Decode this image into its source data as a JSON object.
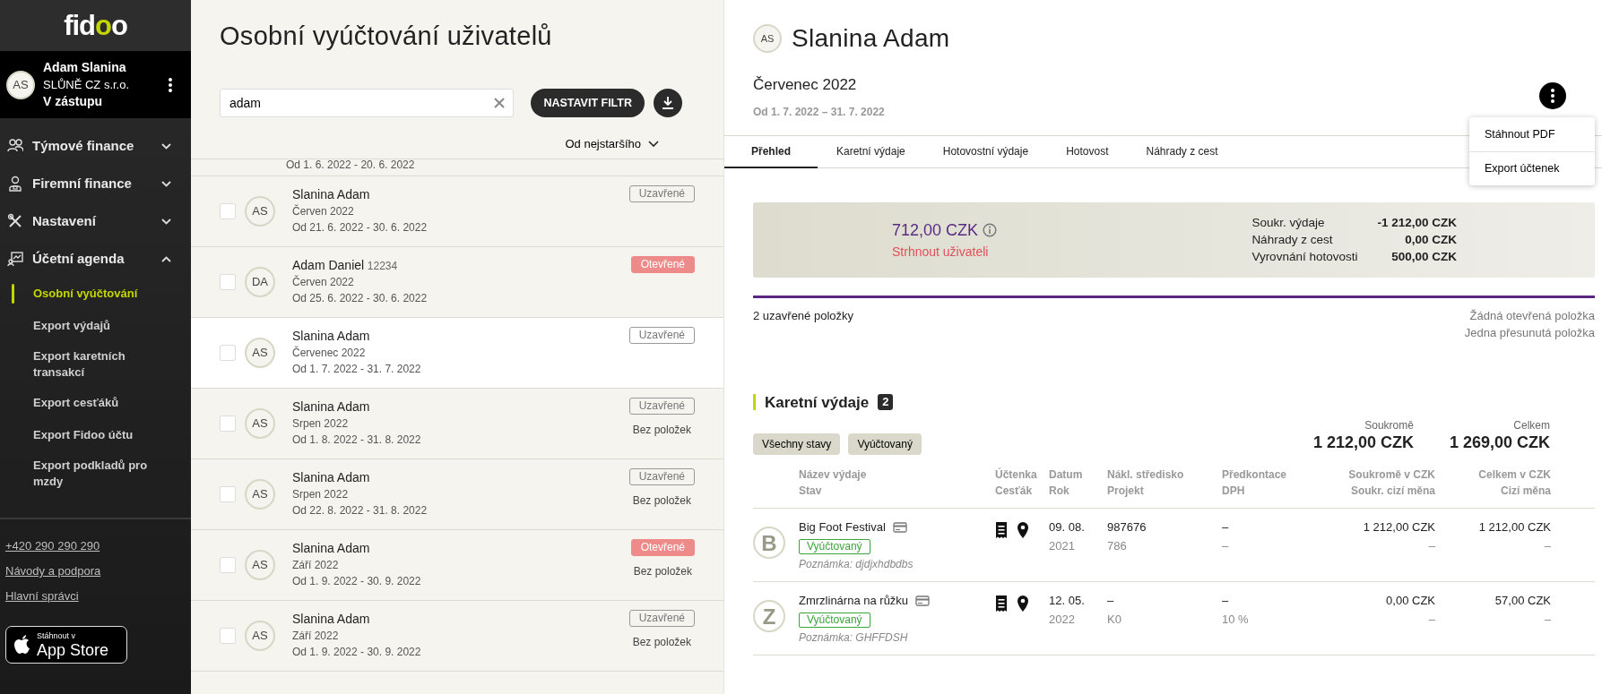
{
  "sidebar": {
    "logo_parts": [
      {
        "text": "fid",
        "accent": false
      },
      {
        "text": "o",
        "accent": true
      },
      {
        "text": "o",
        "accent": false
      }
    ],
    "user": {
      "initials": "AS",
      "name": "Adam Slanina",
      "company": "SLŮNĚ CZ s.r.o.",
      "role": "V zástupu"
    },
    "nav": [
      {
        "label": "Týmové finance",
        "expanded": false
      },
      {
        "label": "Firemní finance",
        "expanded": false
      },
      {
        "label": "Nastavení",
        "expanded": false
      },
      {
        "label": "Účetní agenda",
        "expanded": true,
        "children": [
          {
            "label": "Osobní vyúčtování",
            "selected": true
          },
          {
            "label": "Export výdajů",
            "selected": false
          },
          {
            "label": "Export karetních transakcí",
            "selected": false
          },
          {
            "label": "Export cesťáků",
            "selected": false
          },
          {
            "label": "Export Fidoo účtu",
            "selected": false
          },
          {
            "label": "Export podkladů pro mzdy",
            "selected": false
          }
        ]
      }
    ],
    "footer_links": [
      "+420 290 290 290",
      "Návody a podpora",
      "Hlavní správci"
    ],
    "store_badge": {
      "caption": "Stáhnout v",
      "name": "App Store"
    }
  },
  "list_panel": {
    "title": "Osobní vyúčtování uživatelů",
    "search": {
      "value": "adam"
    },
    "filter_button": "NASTAVIT FILTR",
    "sort": "Od nejstaršího",
    "partial_row": {
      "period": "Od 1. 6. 2022 - 20. 6. 2022"
    },
    "rows": [
      {
        "initials": "AS",
        "name": "Slanina Adam",
        "month": "Červen 2022",
        "period": "Od 21. 6. 2022 - 30. 6. 2022",
        "status": "Uzavřené",
        "open": false,
        "checked": false,
        "selected": false
      },
      {
        "initials": "DA",
        "name": "Adam Daniel",
        "id": "12234",
        "month": "Červen 2022",
        "period": "Od 25. 6. 2022 - 30. 6. 2022",
        "status": "Otevřené",
        "open": true,
        "checked": false,
        "selected": false
      },
      {
        "initials": "AS",
        "name": "Slanina Adam",
        "month": "Červenec 2022",
        "period": "Od 1. 7. 2022 - 31. 7. 2022",
        "status": "Uzavřené",
        "open": false,
        "checked": false,
        "selected": true
      },
      {
        "initials": "AS",
        "name": "Slanina Adam",
        "month": "Srpen 2022",
        "period": "Od 1. 8. 2022 - 31. 8. 2022",
        "status": "Uzavřené",
        "open": false,
        "note": "Bez položek",
        "checked": false,
        "selected": false
      },
      {
        "initials": "AS",
        "name": "Slanina Adam",
        "month": "Srpen 2022",
        "period": "Od 22. 8. 2022 - 31. 8. 2022",
        "status": "Uzavřené",
        "open": false,
        "note": "Bez položek",
        "checked": false,
        "selected": false
      },
      {
        "initials": "AS",
        "name": "Slanina Adam",
        "month": "Září 2022",
        "period": "Od 1. 9. 2022 - 30. 9. 2022",
        "status": "Otevřené",
        "open": true,
        "note": "Bez položek",
        "checked": false,
        "selected": false
      },
      {
        "initials": "AS",
        "name": "Slanina Adam",
        "month": "Září 2022",
        "period": "Od 1. 9. 2022 - 30. 9. 2022",
        "status": "Uzavřené",
        "open": false,
        "note": "Bez položek",
        "checked": false,
        "selected": false
      }
    ]
  },
  "detail": {
    "initials": "AS",
    "name": "Slanina Adam",
    "month": "Červenec 2022",
    "period": "Od 1. 7. 2022 – 31. 7. 2022",
    "menu": [
      "Stáhnout PDF",
      "Export účtenek"
    ],
    "tabs": [
      {
        "label": "Přehled",
        "selected": true
      },
      {
        "label": "Karetní výdaje",
        "selected": false
      },
      {
        "label": "Hotovostní výdaje",
        "selected": false
      },
      {
        "label": "Hotovost",
        "selected": false
      },
      {
        "label": "Náhrady z cest",
        "selected": false
      }
    ],
    "summary": {
      "amount": "712,00 CZK",
      "amount_note": "Strhnout uživateli",
      "lines": [
        {
          "label": "Soukr. výdaje",
          "value": "-1 212,00 CZK"
        },
        {
          "label": "Náhrady z cest",
          "value": "0,00 CZK"
        },
        {
          "label": "Vyrovnání hotovosti",
          "value": "500,00 CZK"
        }
      ]
    },
    "closed_items": "2 uzavřené položky",
    "item_notes": [
      "Žádná otevřená položka",
      "Jedna přesunutá položka"
    ],
    "section": {
      "title": "Karetní výdaje",
      "count": "2",
      "filters": [
        "Všechny stavy",
        "Vyúčtovaný"
      ],
      "totals": [
        {
          "label": "Soukromě",
          "value": "1 212,00 CZK"
        },
        {
          "label": "Celkem",
          "value": "1 269,00 CZK"
        }
      ],
      "columns": [
        {
          "top": "Název výdaje",
          "bottom": "Stav"
        },
        {
          "top": "Účtenka",
          "bottom": "Cesťák"
        },
        {
          "top": "Datum",
          "bottom": "Rok"
        },
        {
          "top": "Nákl. středisko",
          "bottom": "Projekt"
        },
        {
          "top": "Předkontace",
          "bottom": "DPH"
        },
        {
          "top": "Soukromě v CZK",
          "bottom": "Soukr. cizí měna"
        },
        {
          "top": "Celkem v CZK",
          "bottom": "Cizí měna"
        }
      ],
      "rows": [
        {
          "letter": "B",
          "name": "Big Foot Festival",
          "status": "Vyúčtovaný",
          "note": "Poznámka: djdjxhdbdbs",
          "date": "09. 08.",
          "year": "2021",
          "cost_center": "987676",
          "project": "786",
          "account": "–",
          "vat": "–",
          "private": "1 212,00 CZK",
          "private_foreign": "–",
          "total": "1 212,00 CZK",
          "total_foreign": "–"
        },
        {
          "letter": "Z",
          "name": "Zmrzlinárna na růžku",
          "status": "Vyúčtovaný",
          "note": "Poznámka: GHFFDSH",
          "date": "12. 05.",
          "year": "2022",
          "cost_center": "–",
          "project": "K0",
          "account": "–",
          "vat": "10 %",
          "private": "0,00 CZK",
          "private_foreign": "–",
          "total": "57,00 CZK",
          "total_foreign": "–"
        }
      ]
    }
  }
}
